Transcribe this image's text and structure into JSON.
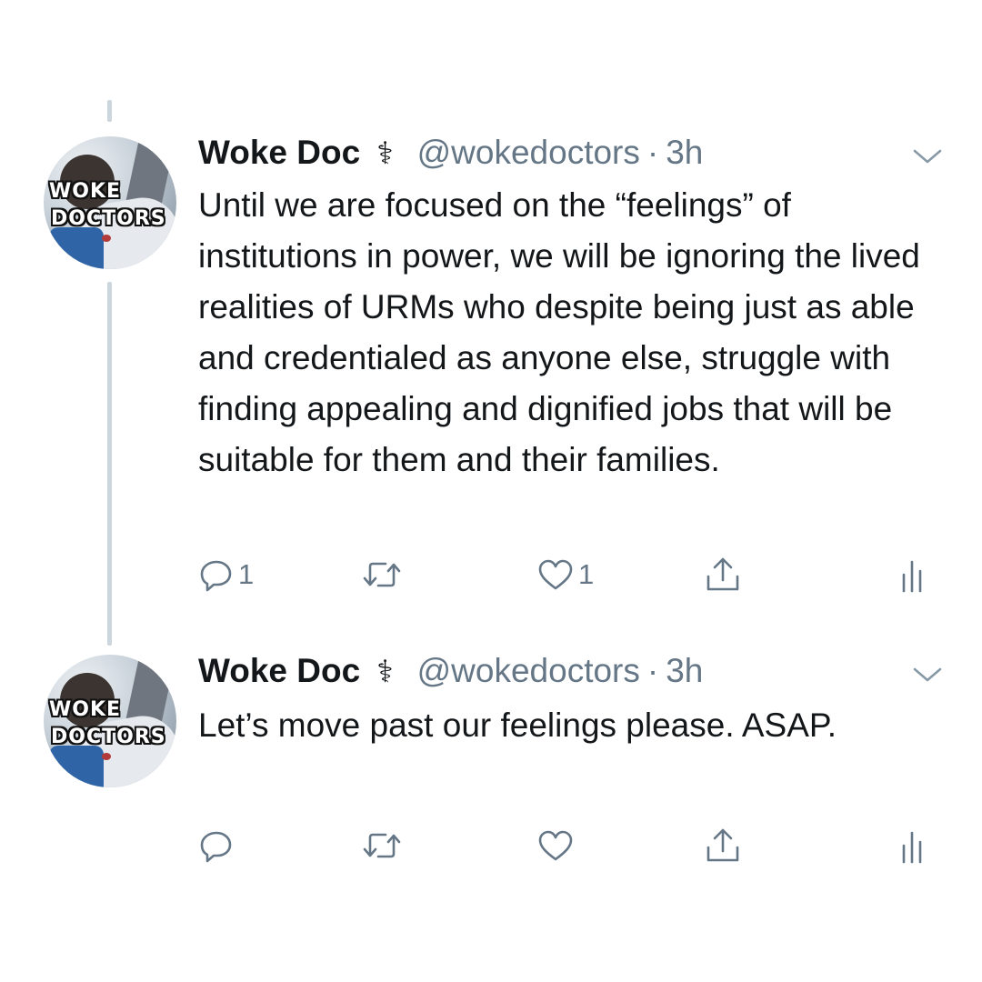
{
  "tweets": [
    {
      "author_name": "Woke Doc",
      "verified_glyph": "⚕",
      "handle": "@wokedoctors",
      "separator": "·",
      "time": "3h",
      "avatar": {
        "line1": "WOKE",
        "line2": "DOCTORS"
      },
      "text": "Until we are focused on the “feelings” of institutions in power, we will be ignoring the lived realities of URMs who despite being just as able and credentialed as anyone else, struggle with finding appealing and dignified jobs that will be suitable for them and their families.",
      "actions": {
        "reply_count": "1",
        "retweet_count": "",
        "like_count": "1"
      }
    },
    {
      "author_name": "Woke Doc",
      "verified_glyph": "⚕",
      "handle": "@wokedoctors",
      "separator": "·",
      "time": "3h",
      "avatar": {
        "line1": "WOKE",
        "line2": "DOCTORS"
      },
      "text": "Let’s move past our feelings please. ASAP.",
      "actions": {
        "reply_count": "",
        "retweet_count": "",
        "like_count": ""
      }
    }
  ],
  "icons": {
    "reply": "reply-icon",
    "retweet": "retweet-icon",
    "like": "heart-icon",
    "share": "share-icon",
    "analytics": "analytics-icon",
    "more": "chevron-down-icon"
  },
  "colors": {
    "text": "#14171a",
    "secondary": "#657786",
    "thread_line": "#ccd6dd"
  }
}
